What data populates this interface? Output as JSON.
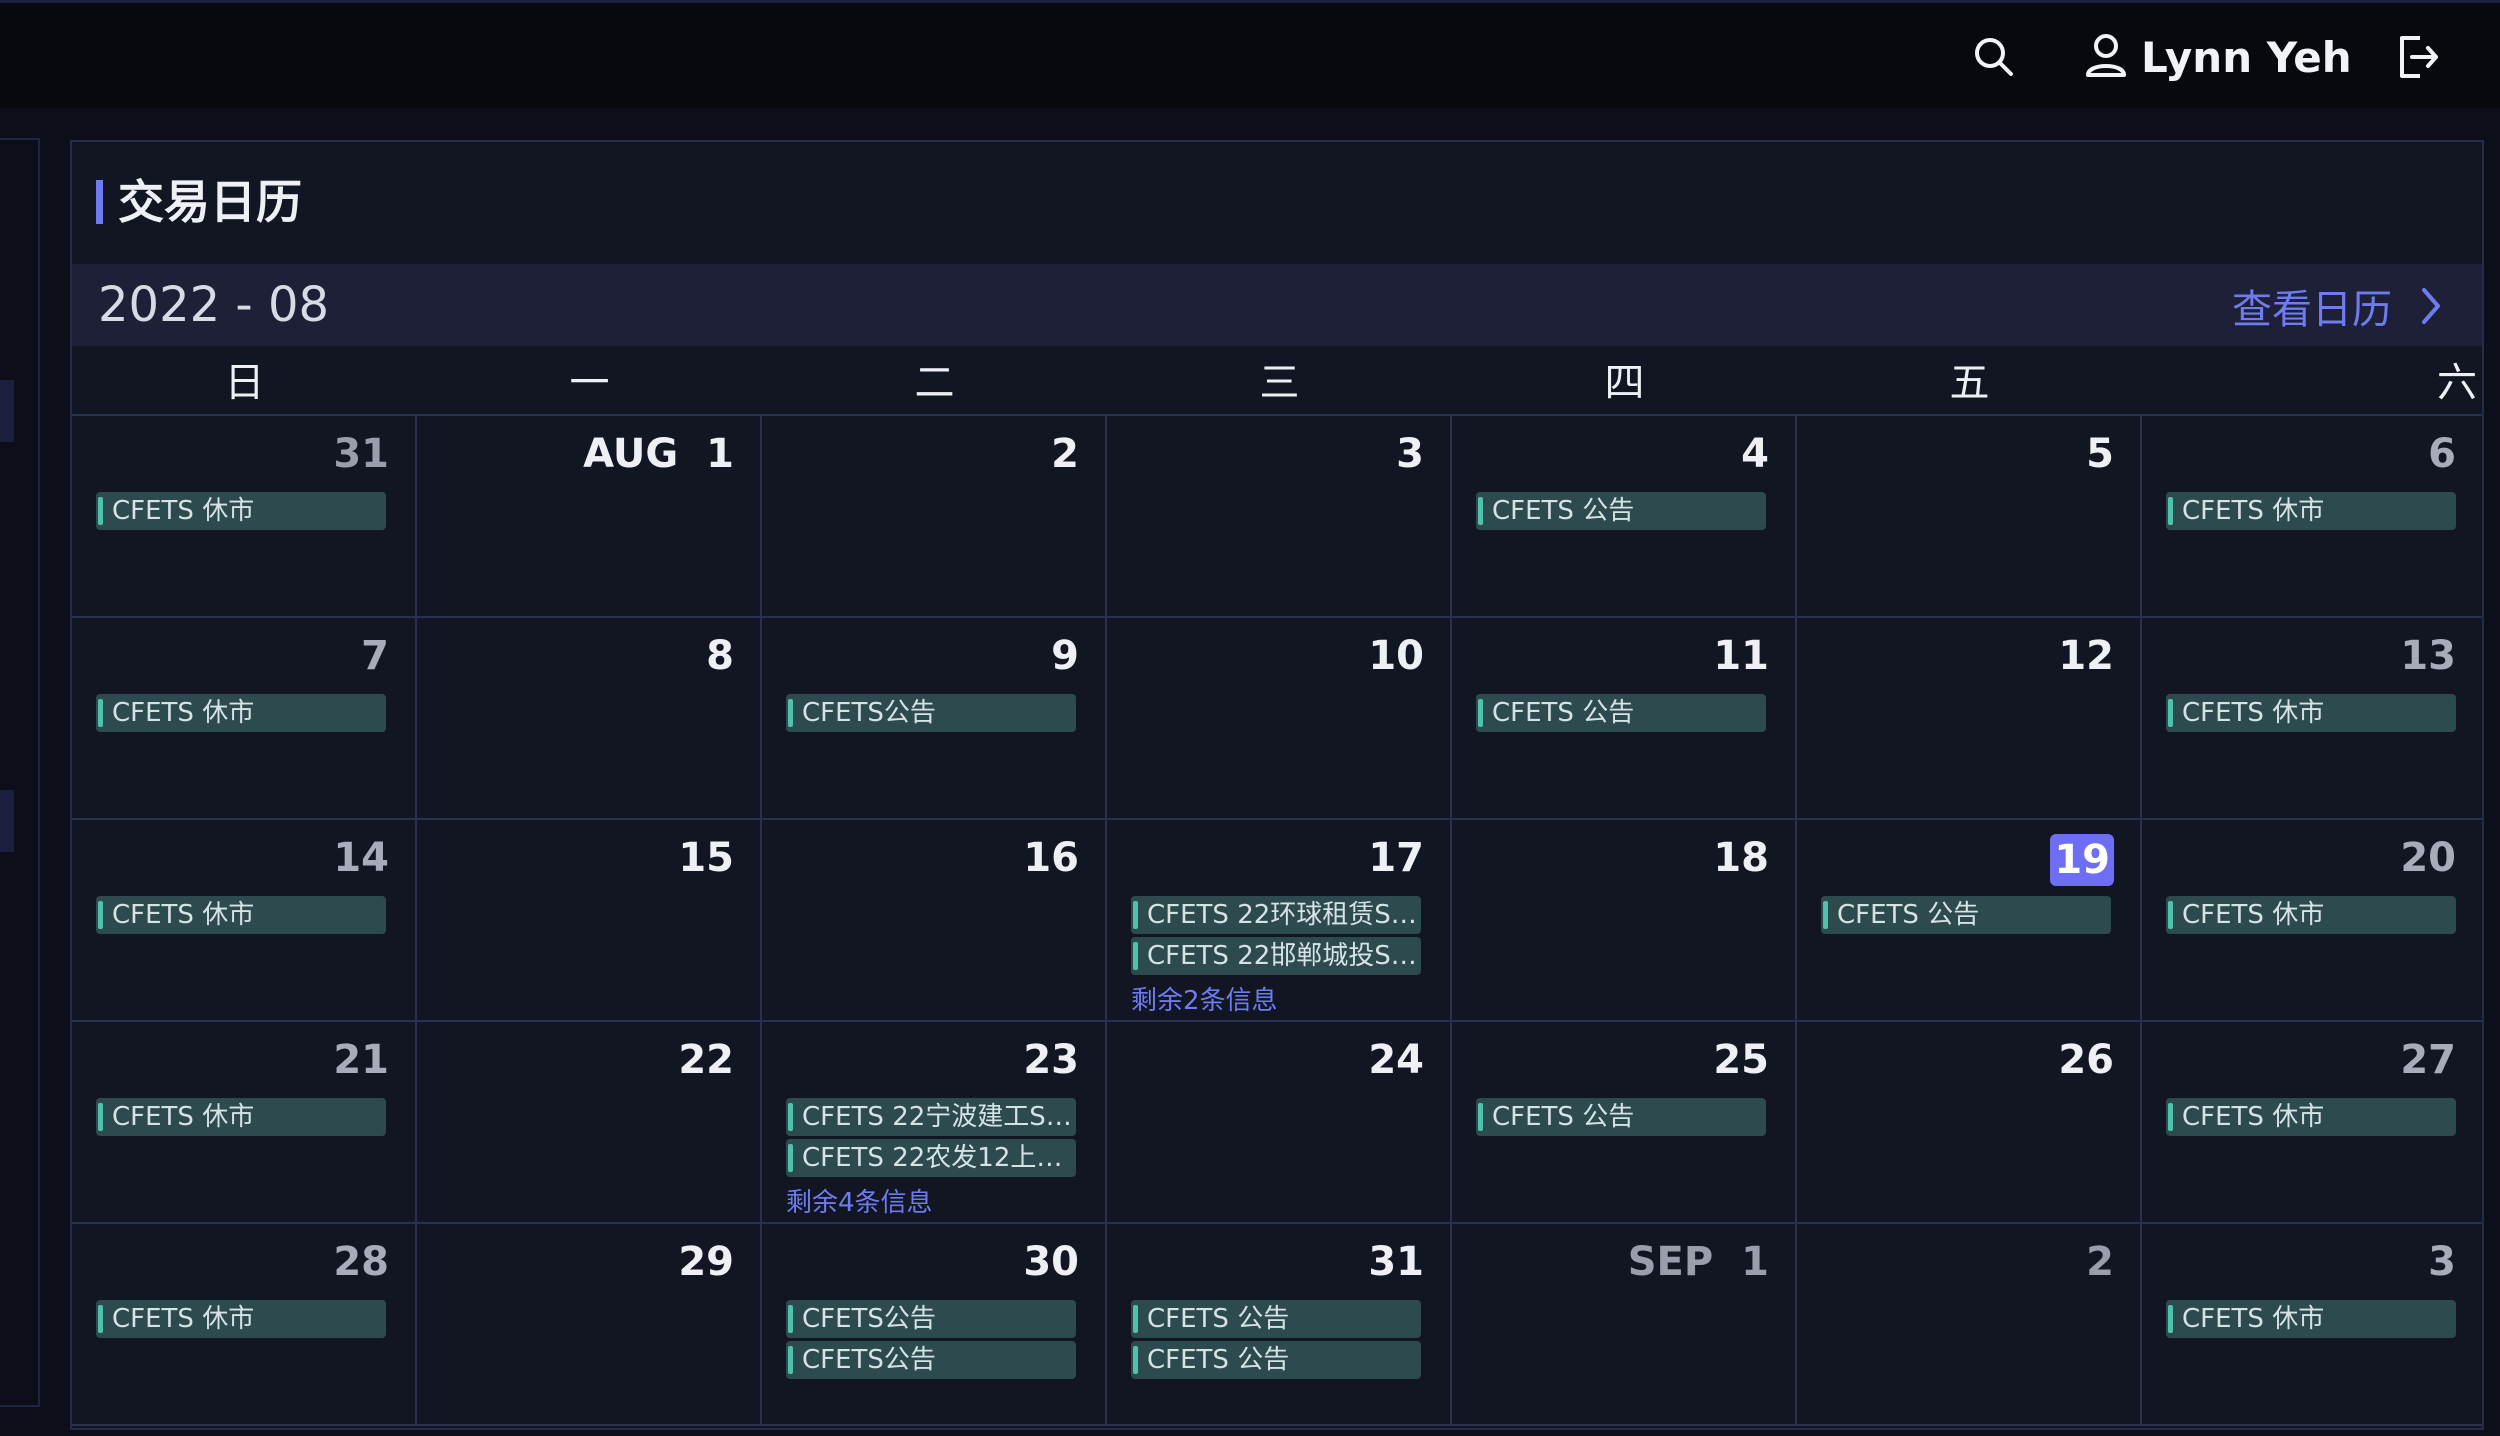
{
  "topbar": {
    "user_name": "Lynn Yeh",
    "icons": [
      "search-icon",
      "user-icon",
      "logout-icon"
    ]
  },
  "panel": {
    "title": "交易日历",
    "month": "2022 - 08",
    "view_calendar_label": "查看日历"
  },
  "weekdays": [
    "日",
    "一",
    "二",
    "三",
    "四",
    "五",
    "六"
  ],
  "weeks": [
    [
      {
        "day": "31",
        "state": "other",
        "events": [
          "CFETS 休市"
        ]
      },
      {
        "day": "1",
        "prefix": "AUG",
        "events": []
      },
      {
        "day": "2",
        "events": []
      },
      {
        "day": "3",
        "events": []
      },
      {
        "day": "4",
        "events": [
          "CFETS 公告"
        ]
      },
      {
        "day": "5",
        "events": []
      },
      {
        "day": "6",
        "state": "weekend",
        "events": [
          "CFETS 休市"
        ]
      }
    ],
    [
      {
        "day": "7",
        "state": "weekend",
        "events": [
          "CFETS 休市"
        ]
      },
      {
        "day": "8",
        "events": []
      },
      {
        "day": "9",
        "events": [
          "CFETS公告"
        ]
      },
      {
        "day": "10",
        "events": []
      },
      {
        "day": "11",
        "events": [
          "CFETS 公告"
        ]
      },
      {
        "day": "12",
        "events": []
      },
      {
        "day": "13",
        "state": "weekend",
        "events": [
          "CFETS 休市"
        ]
      }
    ],
    [
      {
        "day": "14",
        "state": "weekend",
        "events": [
          "CFETS 休市"
        ]
      },
      {
        "day": "15",
        "events": []
      },
      {
        "day": "16",
        "events": []
      },
      {
        "day": "17",
        "events": [
          "CFETS 22环球租赁SC...",
          "CFETS 22邯郸城投SC..."
        ],
        "more": "剩余2条信息"
      },
      {
        "day": "18",
        "events": []
      },
      {
        "day": "19",
        "state": "today",
        "events": [
          "CFETS 公告"
        ]
      },
      {
        "day": "20",
        "state": "weekend",
        "events": [
          "CFETS 休市"
        ]
      }
    ],
    [
      {
        "day": "21",
        "state": "weekend",
        "events": [
          "CFETS 休市"
        ]
      },
      {
        "day": "22",
        "events": []
      },
      {
        "day": "23",
        "events": [
          "CFETS 22宁波建工SC...",
          "CFETS 22农发12上市..."
        ],
        "more": "剩余4条信息"
      },
      {
        "day": "24",
        "events": []
      },
      {
        "day": "25",
        "events": [
          "CFETS 公告"
        ]
      },
      {
        "day": "26",
        "events": []
      },
      {
        "day": "27",
        "state": "weekend",
        "events": [
          "CFETS 休市"
        ]
      }
    ],
    [
      {
        "day": "28",
        "state": "weekend",
        "events": [
          "CFETS 休市"
        ]
      },
      {
        "day": "29",
        "events": []
      },
      {
        "day": "30",
        "events": [
          "CFETS公告",
          "CFETS公告"
        ]
      },
      {
        "day": "31",
        "events": [
          "CFETS 公告",
          "CFETS 公告"
        ]
      },
      {
        "day": "1",
        "prefix": "SEP",
        "state": "other",
        "events": []
      },
      {
        "day": "2",
        "state": "other",
        "events": []
      },
      {
        "day": "3",
        "state": "weekend",
        "events": [
          "CFETS 休市"
        ]
      }
    ]
  ]
}
